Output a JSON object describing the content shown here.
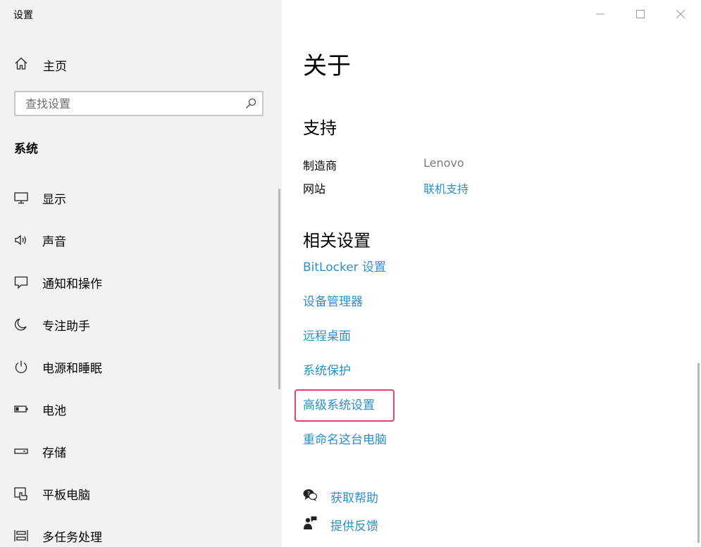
{
  "window": {
    "title": "设置",
    "controls": [
      {
        "name": "minimize",
        "icon": "minimize-icon"
      },
      {
        "name": "maximize",
        "icon": "maximize-icon"
      },
      {
        "name": "close",
        "icon": "close-icon"
      }
    ]
  },
  "sidebar": {
    "home": {
      "label": "主页",
      "icon": "home-icon"
    },
    "search": {
      "placeholder": "查找设置",
      "value": "",
      "icon": "search-icon"
    },
    "section_heading": "系统",
    "items": [
      {
        "label": "显示",
        "icon": "display-icon"
      },
      {
        "label": "声音",
        "icon": "sound-icon"
      },
      {
        "label": "通知和操作",
        "icon": "notification-icon"
      },
      {
        "label": "专注助手",
        "icon": "moon-icon"
      },
      {
        "label": "电源和睡眠",
        "icon": "power-icon"
      },
      {
        "label": "电池",
        "icon": "battery-icon"
      },
      {
        "label": "存储",
        "icon": "storage-icon"
      },
      {
        "label": "平板电脑",
        "icon": "tablet-icon"
      },
      {
        "label": "多任务处理",
        "icon": "multitask-icon"
      }
    ]
  },
  "main": {
    "title": "关于",
    "support": {
      "heading": "支持",
      "manufacturer_label": "制造商",
      "manufacturer_value": "Lenovo",
      "website_label": "网站",
      "website_value": "联机支持"
    },
    "related": {
      "heading": "相关设置",
      "links": [
        "BitLocker 设置",
        "设备管理器",
        "远程桌面",
        "系统保护",
        "高级系统设置",
        "重命名这台电脑"
      ],
      "highlighted": "高级系统设置"
    },
    "help": {
      "get_help": {
        "label": "获取帮助",
        "icon": "help-chat-icon"
      },
      "feedback": {
        "label": "提供反馈",
        "icon": "feedback-icon"
      }
    }
  },
  "colors": {
    "sidebar_bg": "#f2f2f2",
    "link": "#2c8fc8",
    "highlight": "#e8436e"
  }
}
